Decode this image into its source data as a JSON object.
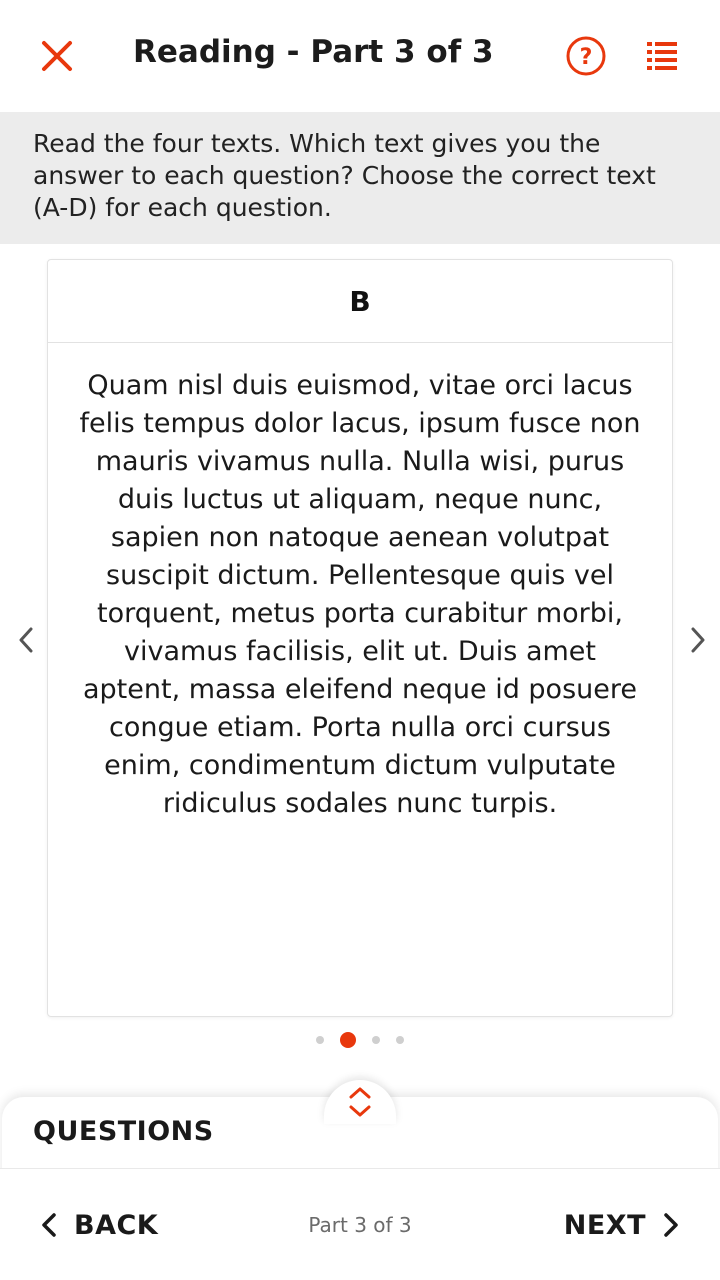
{
  "header": {
    "title": "Reading - Part 3 of 3",
    "close_icon": "close-icon",
    "help_icon": "help-circle-icon",
    "list_icon": "list-icon"
  },
  "instructions": {
    "text": "Read the four texts. Which text gives you the answer to each question? Choose the correct text (A-D) for each question."
  },
  "card": {
    "heading": "B",
    "body": "Quam nisl duis euismod, vitae orci lacus felis tempus dolor lacus, ipsum fusce non mauris vivamus nulla. Nulla wisi, purus duis luctus ut aliquam, neque nunc, sapien non natoque aenean volutpat suscipit dictum. Pellentesque quis vel torquent, metus porta curabitur morbi, vivamus facilisis, elit ut. Duis amet aptent, massa eleifend neque id posuere congue etiam. Porta nulla orci cursus enim, condimentum dictum vulputate ridiculus sodales nunc turpis."
  },
  "carousel": {
    "prev_icon": "chevron-left-icon",
    "next_icon": "chevron-right-icon",
    "page_count": 4,
    "active_index": 1
  },
  "questions_drawer": {
    "label": "QUESTIONS",
    "toggle_icon": "expand-collapse-icon"
  },
  "footer": {
    "back_label": "BACK",
    "next_label": "NEXT",
    "progress_text": "Part 3 of 3"
  },
  "colors": {
    "accent": "#e8380d",
    "instructions_bg": "#ececec",
    "text": "#1a1a1a",
    "muted": "#6b6b6b"
  }
}
